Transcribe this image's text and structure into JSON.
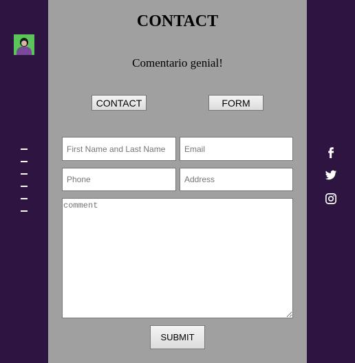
{
  "page": {
    "title": "CONTACT",
    "subtitle": "Comentario genial!"
  },
  "buttons": {
    "contact": "CONTACT",
    "form": "FORM",
    "submit": "SUBMIT"
  },
  "form": {
    "name_placeholder": "First Name and Last Name",
    "email_placeholder": "Email",
    "phone_placeholder": "Phone",
    "address_placeholder": "Address",
    "comment_placeholder": "comment"
  },
  "sidebar": {
    "menu_icon": "hamburger-menu-icon",
    "avatar_icon": "avatar"
  },
  "social": {
    "icons": [
      "facebook-icon",
      "twitter-icon",
      "instagram-icon"
    ]
  },
  "colors": {
    "sidebar_bg": "#2e1541",
    "main_bg": "#a0a0a0",
    "icon_color": "#ffffff"
  }
}
